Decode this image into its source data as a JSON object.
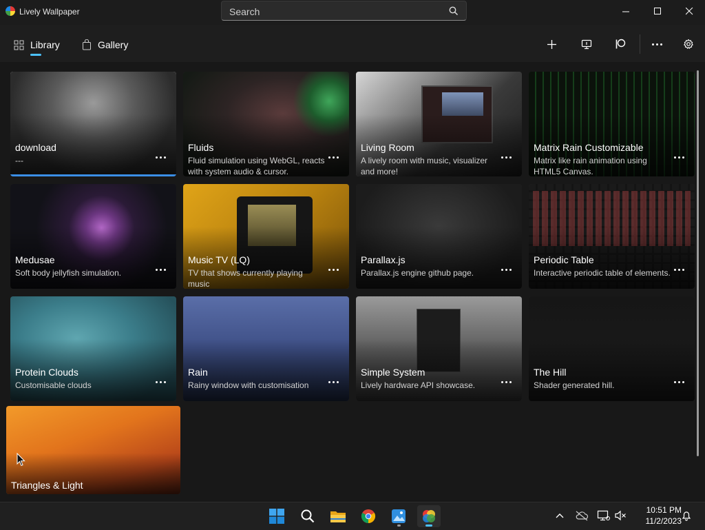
{
  "window": {
    "title": "Lively Wallpaper"
  },
  "search": {
    "placeholder": "Search"
  },
  "nav": {
    "library": "Library",
    "gallery": "Gallery"
  },
  "cards": [
    {
      "title": "download",
      "desc": "---"
    },
    {
      "title": "Fluids",
      "desc": "Fluid simulation using WebGL, reacts with system audio & cursor."
    },
    {
      "title": "Living Room",
      "desc": "A lively room with music, visualizer and more!"
    },
    {
      "title": "Matrix Rain Customizable",
      "desc": "Matrix like rain animation using HTML5 Canvas."
    },
    {
      "title": "Medusae",
      "desc": "Soft body jellyfish simulation."
    },
    {
      "title": "Music TV (LQ)",
      "desc": "TV that shows currently playing music"
    },
    {
      "title": "Parallax.js",
      "desc": "Parallax.js engine github page."
    },
    {
      "title": "Periodic Table",
      "desc": "Interactive periodic table of elements."
    },
    {
      "title": "Protein Clouds",
      "desc": "Customisable clouds"
    },
    {
      "title": "Rain",
      "desc": "Rainy window with customisation"
    },
    {
      "title": "Simple System",
      "desc": "Lively hardware API showcase."
    },
    {
      "title": "The Hill",
      "desc": "Shader generated hill."
    },
    {
      "title": "Triangles & Light",
      "desc": ""
    }
  ],
  "taskbar": {
    "time": "10:51 PM",
    "date": "11/2/2023"
  },
  "colors": {
    "accent": "#4cc2ff",
    "selected_border": "#3a8ee6",
    "background": "#181818",
    "titlebar": "#1c1c1c"
  }
}
